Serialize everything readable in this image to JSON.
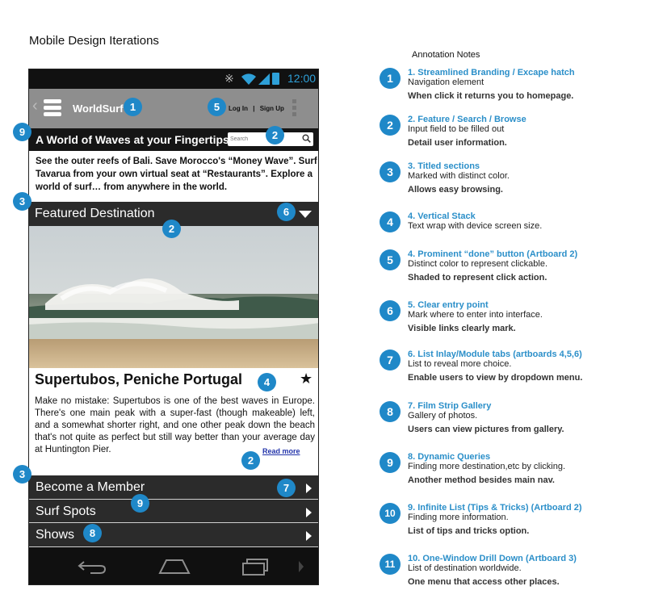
{
  "page_title": "Mobile Design Iterations",
  "phone": {
    "status_bar": {
      "time": "12:00"
    },
    "app_bar": {
      "brand": "WorldSurf",
      "login": "Log In",
      "separator": "|",
      "signup": "Sign Up"
    },
    "hero": {
      "tagline": "A World of Waves at your Fingertips",
      "search_placeholder": "Search"
    },
    "intro_text": "See the outer reefs of Bali. Save Morocco's “Money Wave”. Surf Tavarua from your own virtual seat at “Restaurants”. Explore a world of surf… from anywhere in the world.",
    "featured": {
      "section_label": "Featured Destination",
      "destination_title": "Supertubos, Peniche Portugal",
      "description": "Make no mistake: Supertubos is one of the best waves in Europe. There's one main peak with a super-fast (though makeable) left, and a somewhat shorter right, and one other peak down the beach that's not quite as perfect but still way better than your average day at Huntington Pier.",
      "read_more": "Read more"
    },
    "list_items": [
      {
        "label": "Become a Member"
      },
      {
        "label": "Surf Spots"
      },
      {
        "label": "Shows"
      }
    ]
  },
  "badges": {
    "brand": "1",
    "login": "5",
    "tagline": "9",
    "search": "2",
    "section": "3",
    "dropdown": "6",
    "photo": "2",
    "title": "4",
    "read_more": "2",
    "list": "3",
    "member": "7",
    "surf_spots": "9",
    "shows": "8"
  },
  "annotations": {
    "title": "Annotation Notes",
    "notes": [
      {
        "num": "1",
        "heading": "1. Streamlined Branding / Excape hatch",
        "line1": "Navigation element",
        "line2": "When click it returns you to homepage."
      },
      {
        "num": "2",
        "heading": "2. Feature / Search / Browse",
        "line1": "Input field to be filled out",
        "line2": "Detail user information."
      },
      {
        "num": "3",
        "heading": "3. Titled sections",
        "line1": "Marked with distinct color.",
        "line2": "Allows easy browsing."
      },
      {
        "num": "4",
        "heading": "4. Vertical Stack",
        "line1": "Text wrap with device screen size.",
        "line2": ""
      },
      {
        "num": "5",
        "heading": "4. Prominent “done” button (Artboard 2)",
        "line1": "Distinct color to represent clickable.",
        "line2": "Shaded to represent click action."
      },
      {
        "num": "6",
        "heading": "5. Clear entry point",
        "line1": "Mark where to enter into interface.",
        "line2": "Visible links clearly mark."
      },
      {
        "num": "7",
        "heading": "6. List Inlay/Module tabs (artboards 4,5,6)",
        "line1": "List to reveal more choice.",
        "line2": "Enable users to view by dropdown menu."
      },
      {
        "num": "8",
        "heading": "7. Film Strip Gallery",
        "line1": "Gallery of photos.",
        "line2": "Users can view pictures from gallery."
      },
      {
        "num": "9",
        "heading": "8. Dynamic Queries",
        "line1": "Finding more destination,etc by clicking.",
        "line2": "Another method besides main nav."
      },
      {
        "num": "10",
        "heading": "9. Infinite List (Tips & Tricks) (Artboard 2)",
        "line1": "Finding more information.",
        "line2": "List of tips and tricks option."
      },
      {
        "num": "11",
        "heading": "10. One-Window Drill Down (Artboard 3)",
        "line1": "List of destination worldwide.",
        "line2": "One menu that access other places."
      }
    ]
  }
}
